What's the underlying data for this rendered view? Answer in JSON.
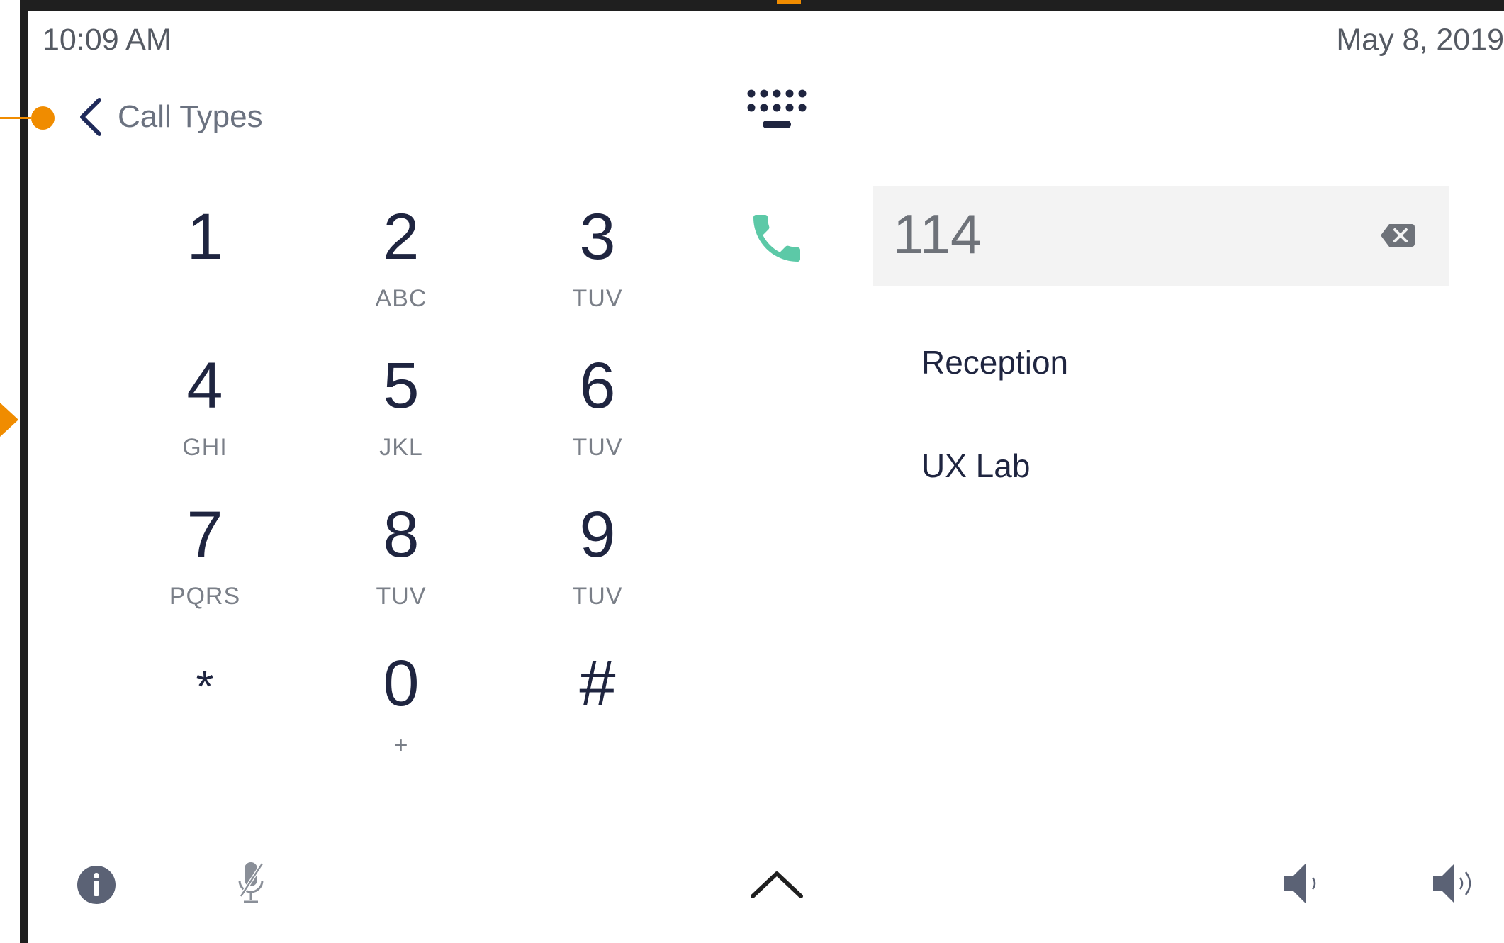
{
  "status": {
    "time": "10:09 AM",
    "date": "May 8, 2019"
  },
  "nav": {
    "back_label": "Call Types",
    "back_icon": "chevron-left-icon",
    "keyboard_icon": "keyboard-icon"
  },
  "keypad": {
    "keys": [
      {
        "digit": "1",
        "letters": ""
      },
      {
        "digit": "2",
        "letters": "ABC"
      },
      {
        "digit": "3",
        "letters": "TUV"
      },
      {
        "digit": "4",
        "letters": "GHI"
      },
      {
        "digit": "5",
        "letters": "JKL"
      },
      {
        "digit": "6",
        "letters": "TUV"
      },
      {
        "digit": "7",
        "letters": "PQRS"
      },
      {
        "digit": "8",
        "letters": "TUV"
      },
      {
        "digit": "9",
        "letters": "TUV"
      },
      {
        "digit": "*",
        "letters": ""
      },
      {
        "digit": "0",
        "letters": "+"
      },
      {
        "digit": "#",
        "letters": ""
      }
    ]
  },
  "dial": {
    "number": "114",
    "call_icon": "phone-icon",
    "backspace_icon": "backspace-icon"
  },
  "contacts": [
    "Reception",
    "UX Lab"
  ],
  "bottom_bar": {
    "info_icon": "info-icon",
    "mic_icon": "microphone-muted-icon",
    "expand_icon": "chevron-up-icon",
    "volume_down_icon": "volume-down-icon",
    "volume_up_icon": "volume-up-icon"
  },
  "colors": {
    "accent": "#f08c00",
    "call_green": "#5cc9a7",
    "text_dark": "#1f2540",
    "text_muted": "#7a7f88",
    "field_bg": "#f3f3f3"
  }
}
